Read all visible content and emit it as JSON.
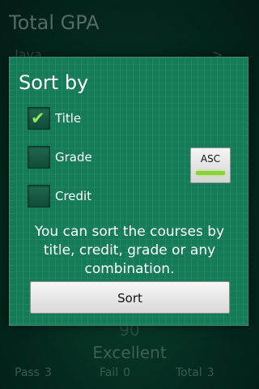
{
  "background": {
    "title": "Total GPA",
    "peek_row_label": "Java",
    "peek_row_arrow": ">",
    "score": "90",
    "status": "Excellent",
    "stats": [
      {
        "label": "Pass",
        "value": "3"
      },
      {
        "label": "Fail",
        "value": "0"
      },
      {
        "label": "Total",
        "value": "3"
      }
    ]
  },
  "dialog": {
    "title": "Sort by",
    "options": [
      {
        "label": "Title",
        "checked": true
      },
      {
        "label": "Grade",
        "checked": false
      },
      {
        "label": "Credit",
        "checked": false
      }
    ],
    "order_toggle": {
      "label": "ASC",
      "active": true
    },
    "message": "You can sort the courses by title, credit, grade or any combination.",
    "sort_button": "Sort"
  },
  "colors": {
    "dialog_bg": "#147a57",
    "check_mark": "#8fe65a",
    "toggle_indicator": "#8bd23a"
  }
}
